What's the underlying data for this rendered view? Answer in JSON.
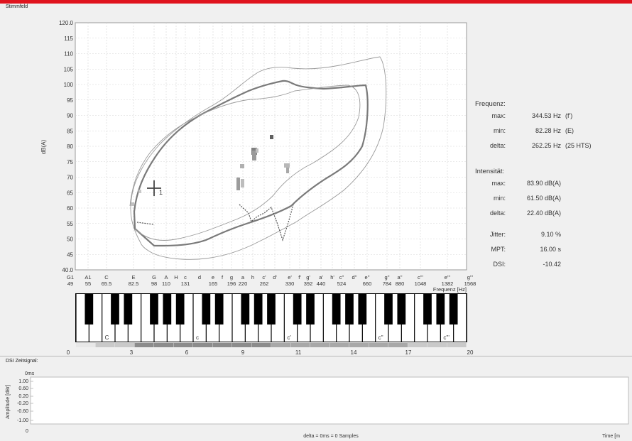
{
  "window": {
    "section_title": "Stimmfeld"
  },
  "chart_data": {
    "type": "line",
    "ylabel": "dB(A)",
    "xlabel": "Frequenz [Hz]",
    "ylim": [
      40,
      120
    ],
    "y_ticks": [
      "40.0",
      "45",
      "50",
      "55",
      "60",
      "65",
      "70",
      "75",
      "80",
      "85",
      "90",
      "95",
      "100",
      "105",
      "110",
      "115",
      "120.0"
    ],
    "x_ticks": [
      {
        "note": "G1",
        "hz": "49"
      },
      {
        "note": "A1",
        "hz": "55"
      },
      {
        "note": "C",
        "hz": "65.5"
      },
      {
        "note": "E",
        "hz": "82.5"
      },
      {
        "note": "G",
        "hz": "98"
      },
      {
        "note": "A",
        "hz": "110"
      },
      {
        "note": "H",
        "hz": ""
      },
      {
        "note": "c",
        "hz": "131"
      },
      {
        "note": "d",
        "hz": ""
      },
      {
        "note": "e",
        "hz": "165"
      },
      {
        "note": "f",
        "hz": ""
      },
      {
        "note": "g",
        "hz": "196"
      },
      {
        "note": "a",
        "hz": "220"
      },
      {
        "note": "h",
        "hz": ""
      },
      {
        "note": "c'",
        "hz": "262"
      },
      {
        "note": "d'",
        "hz": ""
      },
      {
        "note": "e'",
        "hz": "330"
      },
      {
        "note": "f'",
        "hz": ""
      },
      {
        "note": "g'",
        "hz": "392"
      },
      {
        "note": "a'",
        "hz": "440"
      },
      {
        "note": "h'",
        "hz": ""
      },
      {
        "note": "c''",
        "hz": "524"
      },
      {
        "note": "d''",
        "hz": ""
      },
      {
        "note": "e''",
        "hz": "660"
      },
      {
        "note": "g''",
        "hz": "784"
      },
      {
        "note": "a''",
        "hz": "880"
      },
      {
        "note": "c'''",
        "hz": "1048"
      },
      {
        "note": "e'''",
        "hz": "1382"
      },
      {
        "note": "g'''",
        "hz": "1568"
      }
    ],
    "marker_label": "1",
    "grid": true
  },
  "stats": {
    "frequenz": {
      "title": "Frequenz:",
      "rows": [
        {
          "label": "max:",
          "value": "344.53 Hz",
          "extra": "(f')"
        },
        {
          "label": "min:",
          "value": "82.28 Hz",
          "extra": "(E)"
        },
        {
          "label": "delta:",
          "value": "262.25 Hz",
          "extra": "(25 HTS)"
        }
      ]
    },
    "intensitaet": {
      "title": "Intensität:",
      "rows": [
        {
          "label": "max:",
          "value": "83.90 dB(A)"
        },
        {
          "label": "min:",
          "value": "61.50 dB(A)"
        },
        {
          "label": "delta:",
          "value": "22.40 dB(A)"
        }
      ]
    },
    "other": [
      {
        "label": "Jitter:",
        "value": "9.10 %"
      },
      {
        "label": "MPT:",
        "value": "16.00 s"
      },
      {
        "label": "DSI:",
        "value": "-10.42"
      }
    ]
  },
  "piano": {
    "labels": [
      "C",
      "c",
      "c'",
      "c''",
      "c'''"
    ],
    "scale": [
      "0",
      "3",
      "6",
      "9",
      "11",
      "14",
      "17",
      "20"
    ]
  },
  "dsi": {
    "title": "DSI Zeitsignal:",
    "time_start": "0ms",
    "ylabel": "Amplitude [dBr]",
    "y_ticks": [
      "1.00",
      "0.60",
      "0.20",
      "-0.20",
      "-0.60",
      "-1.00"
    ],
    "x_start": "0",
    "status": "delta = 0ms = 0 Samples",
    "x_end": "Time [m"
  }
}
